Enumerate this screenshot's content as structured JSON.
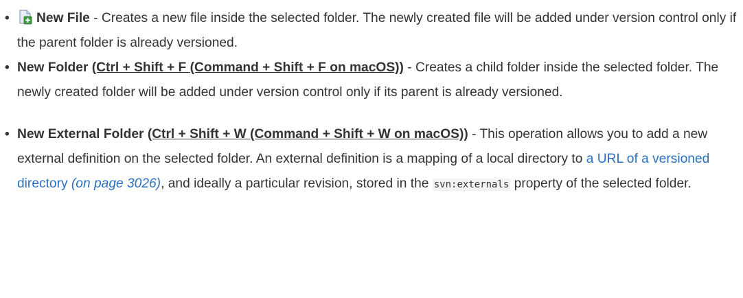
{
  "items": [
    {
      "icon": "new-file-icon",
      "title": "New File",
      "desc": " - Creates a new file inside the selected folder. The newly created file will be added under version control only if the parent folder is already versioned."
    },
    {
      "title": "New Folder",
      "shortcut": "(Ctrl + Shift + F (Command + Shift + F on macOS))",
      "desc": " - Creates a child folder inside the selected folder. The newly created folder will be added under version control only if its parent is already versioned."
    },
    {
      "title": "New External Folder",
      "shortcut": "(Ctrl + Shift + W (Command + Shift + W on macOS))",
      "desc_before_link": " - This operation allows you to add a new external definition on the selected folder. An external definition is a mapping of a local directory to ",
      "link_text": "a URL of a versioned directory",
      "page_ref": " (on page 3026)",
      "desc_after_link": ", and ideally a particular revision, stored in the ",
      "code": "svn:externals",
      "desc_end": " property of the selected folder."
    }
  ],
  "bullet_char": "•",
  "colors": {
    "text": "#333333",
    "link": "#2a6fbf",
    "code_bg": "#f3f3f3"
  }
}
